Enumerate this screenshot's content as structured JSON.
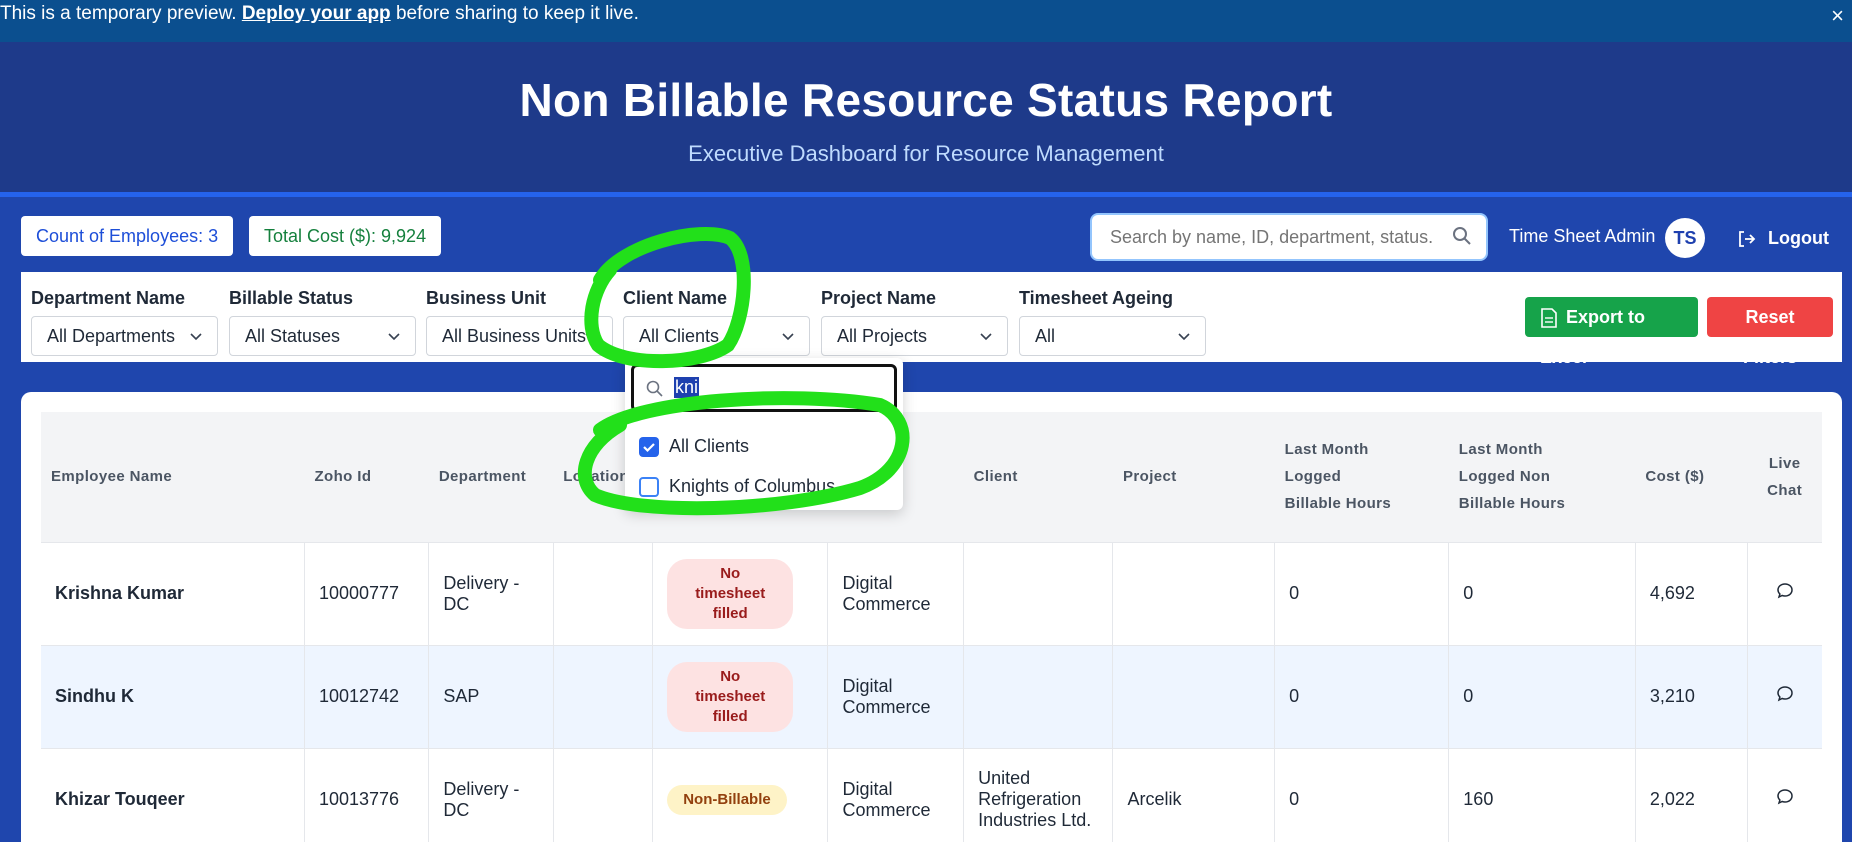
{
  "preview": {
    "text_before": "This is a temporary preview.",
    "link": "Deploy your app",
    "text_after": "before sharing to keep it live.",
    "close": "×"
  },
  "header": {
    "title": "Non Billable Resource Status Report",
    "subtitle": "Executive Dashboard for Resource Management"
  },
  "stats": {
    "employees": "Count of Employees: 3",
    "cost": "Total Cost ($): 9,924"
  },
  "search": {
    "placeholder": "Search by name, ID, department, status..."
  },
  "user": {
    "name": "Time Sheet Admin",
    "initials": "TS",
    "logout": "Logout"
  },
  "filters": [
    {
      "label": "Department Name",
      "value": "All Departments"
    },
    {
      "label": "Billable Status",
      "value": "All Statuses"
    },
    {
      "label": "Business Unit",
      "value": "All Business Units"
    },
    {
      "label": "Client Name",
      "value": "All Clients"
    },
    {
      "label": "Project Name",
      "value": "All Projects"
    },
    {
      "label": "Timesheet Ageing",
      "value": "All"
    }
  ],
  "actions": {
    "export": "Export to Excel",
    "reset": "Reset Filters"
  },
  "dropdown": {
    "search_text": "kni",
    "options": [
      {
        "label": "All Clients",
        "checked": true
      },
      {
        "label": "Knights of Columbus",
        "checked": false
      }
    ]
  },
  "table": {
    "headers": {
      "name": "Employee Name",
      "zoho": "Zoho Id",
      "dept": "Department",
      "location": "Location",
      "client": "Client",
      "project": "Project",
      "billable_1": "Last Month",
      "billable_2": "Logged",
      "billable_3": "Billable Hours",
      "nonbill_1": "Last Month",
      "nonbill_2": "Logged Non",
      "nonbill_3": "Billable Hours",
      "cost": "Cost ($)",
      "chat_1": "Live",
      "chat_2": "Chat"
    },
    "rows": [
      {
        "name": "Krishna Kumar",
        "zoho": "10000777",
        "dept": "Delivery - DC",
        "location": "",
        "status_1": "No timesheet",
        "status_2": "filled",
        "bu_1": "Digital",
        "bu_2": "Commerce",
        "client_1": "",
        "client_2": "",
        "client_3": "",
        "project": "",
        "billable": "0",
        "nonbillable": "0",
        "cost": "4,692"
      },
      {
        "name": "Sindhu K",
        "zoho": "10012742",
        "dept": "SAP",
        "location": "",
        "status_1": "No timesheet",
        "status_2": "filled",
        "bu_1": "Digital",
        "bu_2": "Commerce",
        "client_1": "",
        "client_2": "",
        "client_3": "",
        "project": "",
        "billable": "0",
        "nonbillable": "0",
        "cost": "3,210"
      },
      {
        "name": "Khizar Touqeer",
        "zoho": "10013776",
        "dept": "Delivery - DC",
        "location": "",
        "status": "Non-Billable",
        "bu_1": "Digital",
        "bu_2": "Commerce",
        "client_1": "United",
        "client_2": "Refrigeration",
        "client_3": "Industries Ltd.",
        "project": "Arcelik",
        "billable": "0",
        "nonbillable": "160",
        "cost": "2,022"
      }
    ]
  },
  "colors": {
    "page_bg": "#1f46ad",
    "header_bg": "#1e3a8a",
    "export": "#16a34a",
    "reset": "#ef4444",
    "annotation": "#22e01a"
  },
  "icons": [
    "close-icon",
    "search-icon",
    "logout-icon",
    "chevron-down-icon",
    "file-excel-icon",
    "check-icon",
    "chat-bubble-icon"
  ]
}
